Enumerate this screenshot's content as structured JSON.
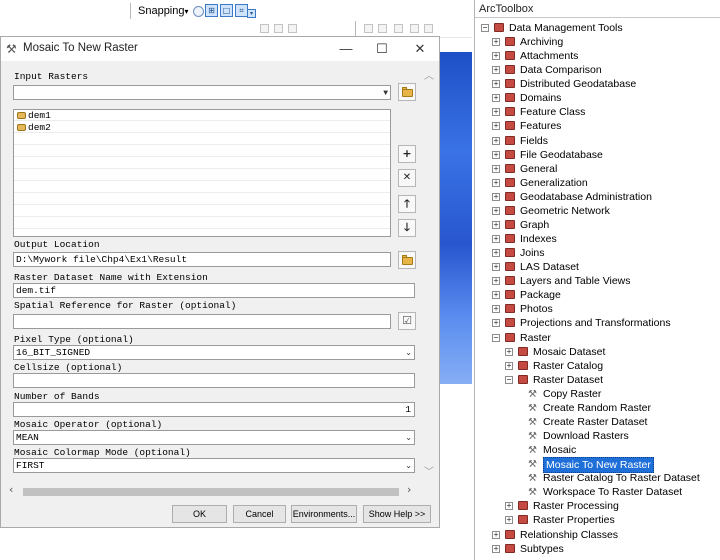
{
  "toolbar": {
    "snapping_label": "Snapping",
    "snapping_arrow": "▾"
  },
  "dialog": {
    "title": "Mosaic To New Raster",
    "minimize": "—",
    "maximize": "☐",
    "close": "✕",
    "input_rasters_label": "Input Rasters",
    "input_rasters_value": "",
    "rasters": [
      "dem1",
      "dem2"
    ],
    "output_location_label": "Output Location",
    "output_location_value": "D:\\Mywork file\\Chp4\\Ex1\\Result",
    "raster_name_label": "Raster Dataset Name with Extension",
    "raster_name_value": "dem.tif",
    "spatial_ref_label": "Spatial Reference for Raster (optional)",
    "spatial_ref_value": "",
    "pixel_type_label": "Pixel Type (optional)",
    "pixel_type_value": "16_BIT_SIGNED",
    "cellsize_label": "Cellsize (optional)",
    "cellsize_value": "",
    "bands_label": "Number of Bands",
    "bands_value": "1",
    "operator_label": "Mosaic Operator (optional)",
    "operator_value": "MEAN",
    "colormap_label": "Mosaic Colormap Mode (optional)",
    "colormap_value": "FIRST",
    "buttons": {
      "ok": "OK",
      "cancel": "Cancel",
      "environments": "Environments...",
      "show_help": "Show Help >>"
    }
  },
  "toolbox": {
    "title": "ArcToolbox",
    "root": "Data Management Tools",
    "categories": [
      "Archiving",
      "Attachments",
      "Data Comparison",
      "Distributed Geodatabase",
      "Domains",
      "Feature Class",
      "Features",
      "Fields",
      "File Geodatabase",
      "General",
      "Generalization",
      "Geodatabase Administration",
      "Geometric Network",
      "Graph",
      "Indexes",
      "Joins",
      "LAS Dataset",
      "Layers and Table Views",
      "Package",
      "Photos",
      "Projections and Transformations"
    ],
    "raster": "Raster",
    "raster_children_top": [
      "Mosaic Dataset",
      "Raster Catalog"
    ],
    "raster_dataset": "Raster Dataset",
    "raster_dataset_tools": [
      "Copy Raster",
      "Create Random Raster",
      "Create Raster Dataset",
      "Download Rasters",
      "Mosaic",
      "Mosaic To New Raster",
      "Raster Catalog To Raster Dataset",
      "Workspace To Raster Dataset"
    ],
    "selected_tool": "Mosaic To New Raster",
    "raster_children_bottom": [
      "Raster Processing",
      "Raster Properties"
    ],
    "after_raster": [
      "Relationship Classes",
      "Subtypes"
    ]
  }
}
